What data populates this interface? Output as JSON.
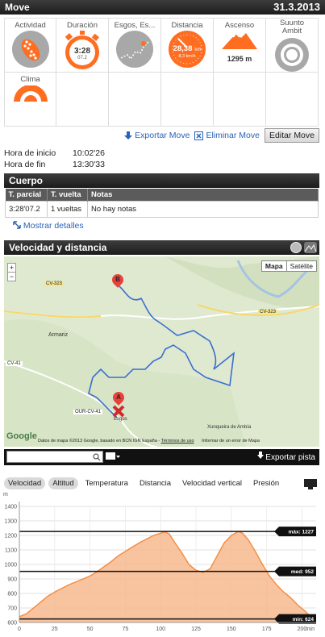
{
  "header": {
    "title": "Move",
    "date": "31.3.2013"
  },
  "tiles": [
    {
      "label": "Actividad",
      "icon": "running-shoe-icon"
    },
    {
      "label": "Duración",
      "icon": "stopwatch-icon",
      "value": "3:28",
      "sub": "07.2"
    },
    {
      "label": "Esgos, Es...",
      "icon": "route-map-icon"
    },
    {
      "label": "Distancia",
      "icon": "speedometer-icon",
      "value": "28,38",
      "unit": "km",
      "sub": "8,3 km/h"
    },
    {
      "label": "Ascenso",
      "icon": "mountain-icon",
      "value": "1295 m"
    },
    {
      "label": "Suunto Ambit",
      "icon": "watch-icon"
    },
    {
      "label": "Clima",
      "icon": "weather-icon"
    }
  ],
  "actions": {
    "export": "Exportar Move",
    "delete": "Eliminar Move",
    "edit": "Editar Move"
  },
  "times": [
    {
      "label": "Hora de inicio",
      "value": "10:02'26"
    },
    {
      "label": "Hora de fin",
      "value": "13:30'33"
    }
  ],
  "body_section": {
    "title": "Cuerpo",
    "columns": [
      "T. parcial",
      "T. vuelta",
      "Notas"
    ],
    "rows": [
      [
        "3:28'07.2",
        "1 vueltas",
        "No hay notas"
      ]
    ],
    "details": "Mostrar detalles"
  },
  "speed_section": {
    "title": "Velocidad y distancia"
  },
  "map": {
    "type_map": "Mapa",
    "type_sat": "Satélite",
    "roads": [
      "CV-323",
      "CV-323",
      "CV-41",
      "OUR-CV-41"
    ],
    "places": [
      "Armariz",
      "Esgos",
      "Xunqueira de Ambía"
    ],
    "marker_a": "A",
    "marker_b": "B",
    "attribution": "Datos de mapa ©2013 Google, basado en BCN IGN España -",
    "terms": "Términos de uso",
    "report": "Informar de un error de Mapa",
    "google": "Google",
    "zoom_in": "+",
    "zoom_out": "−"
  },
  "search": {
    "placeholder": "",
    "export_track": "Exportar pista"
  },
  "chart_tabs": [
    "Velocidad",
    "Altitud",
    "Temperatura",
    "Distancia",
    "Velocidad vertical",
    "Presión"
  ],
  "chart_data": {
    "type": "area",
    "ylabel": "m",
    "xlabel": "min",
    "ylim": [
      600,
      1400
    ],
    "xlim": [
      0,
      210
    ],
    "yticks": [
      600,
      700,
      800,
      900,
      1000,
      1100,
      1200,
      1300,
      1400
    ],
    "xticks": [
      0,
      25,
      50,
      75,
      100,
      125,
      150,
      175,
      200
    ],
    "series": [
      {
        "values": [
          [
            0,
            640
          ],
          [
            5,
            660
          ],
          [
            10,
            700
          ],
          [
            15,
            740
          ],
          [
            20,
            780
          ],
          [
            25,
            810
          ],
          [
            30,
            835
          ],
          [
            35,
            860
          ],
          [
            40,
            880
          ],
          [
            45,
            900
          ],
          [
            50,
            920
          ],
          [
            55,
            950
          ],
          [
            60,
            985
          ],
          [
            65,
            1020
          ],
          [
            70,
            1060
          ],
          [
            75,
            1090
          ],
          [
            80,
            1120
          ],
          [
            85,
            1150
          ],
          [
            90,
            1175
          ],
          [
            95,
            1200
          ],
          [
            100,
            1215
          ],
          [
            103,
            1225
          ],
          [
            106,
            1210
          ],
          [
            110,
            1150
          ],
          [
            115,
            1080
          ],
          [
            120,
            1000
          ],
          [
            125,
            960
          ],
          [
            130,
            945
          ],
          [
            135,
            970
          ],
          [
            140,
            1060
          ],
          [
            145,
            1150
          ],
          [
            150,
            1200
          ],
          [
            155,
            1227
          ],
          [
            158,
            1215
          ],
          [
            162,
            1170
          ],
          [
            167,
            1090
          ],
          [
            172,
            1000
          ],
          [
            177,
            920
          ],
          [
            182,
            860
          ],
          [
            187,
            810
          ],
          [
            192,
            770
          ],
          [
            197,
            720
          ],
          [
            202,
            680
          ],
          [
            207,
            630
          ]
        ]
      }
    ],
    "lines": [
      {
        "label": "máx: 1227",
        "value": 1227
      },
      {
        "label": "med: 952",
        "value": 952
      },
      {
        "label": "mín: 624",
        "value": 624
      }
    ],
    "colors": {
      "fill": "#f7b98e",
      "line": "#f58a3c"
    }
  }
}
